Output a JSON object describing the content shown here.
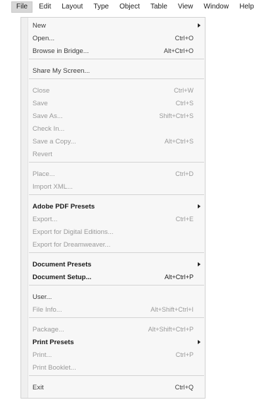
{
  "menubar": {
    "items": [
      {
        "label": "File"
      },
      {
        "label": "Edit"
      },
      {
        "label": "Layout"
      },
      {
        "label": "Type"
      },
      {
        "label": "Object"
      },
      {
        "label": "Table"
      },
      {
        "label": "View"
      },
      {
        "label": "Window"
      },
      {
        "label": "Help"
      }
    ]
  },
  "file_menu": {
    "items": [
      {
        "label": "New",
        "shortcut": "",
        "state": "normal",
        "submenu": true
      },
      {
        "label": "Open...",
        "shortcut": "Ctrl+O",
        "state": "normal",
        "submenu": false
      },
      {
        "label": "Browse in Bridge...",
        "shortcut": "Alt+Ctrl+O",
        "state": "normal",
        "submenu": false
      },
      {
        "label": "Share My Screen...",
        "shortcut": "",
        "state": "normal",
        "submenu": false
      },
      {
        "label": "Close",
        "shortcut": "Ctrl+W",
        "state": "disabled",
        "submenu": false
      },
      {
        "label": "Save",
        "shortcut": "Ctrl+S",
        "state": "disabled",
        "submenu": false
      },
      {
        "label": "Save As...",
        "shortcut": "Shift+Ctrl+S",
        "state": "disabled",
        "submenu": false
      },
      {
        "label": "Check In...",
        "shortcut": "",
        "state": "disabled",
        "submenu": false
      },
      {
        "label": "Save a Copy...",
        "shortcut": "Alt+Ctrl+S",
        "state": "disabled",
        "submenu": false
      },
      {
        "label": "Revert",
        "shortcut": "",
        "state": "disabled",
        "submenu": false
      },
      {
        "label": "Place...",
        "shortcut": "Ctrl+D",
        "state": "disabled",
        "submenu": false
      },
      {
        "label": "Import XML...",
        "shortcut": "",
        "state": "disabled",
        "submenu": false
      },
      {
        "label": "Adobe PDF Presets",
        "shortcut": "",
        "state": "enabled",
        "submenu": true
      },
      {
        "label": "Export...",
        "shortcut": "Ctrl+E",
        "state": "disabled",
        "submenu": false
      },
      {
        "label": "Export for Digital Editions...",
        "shortcut": "",
        "state": "disabled",
        "submenu": false
      },
      {
        "label": "Export for Dreamweaver...",
        "shortcut": "",
        "state": "disabled",
        "submenu": false
      },
      {
        "label": "Document Presets",
        "shortcut": "",
        "state": "enabled",
        "submenu": true
      },
      {
        "label": "Document Setup...",
        "shortcut": "Alt+Ctrl+P",
        "state": "enabled",
        "submenu": false
      },
      {
        "label": "User...",
        "shortcut": "",
        "state": "normal",
        "submenu": false
      },
      {
        "label": "File Info...",
        "shortcut": "Alt+Shift+Ctrl+I",
        "state": "disabled",
        "submenu": false
      },
      {
        "label": "Package...",
        "shortcut": "Alt+Shift+Ctrl+P",
        "state": "disabled",
        "submenu": false
      },
      {
        "label": "Print Presets",
        "shortcut": "",
        "state": "enabled",
        "submenu": true
      },
      {
        "label": "Print...",
        "shortcut": "Ctrl+P",
        "state": "disabled",
        "submenu": false
      },
      {
        "label": "Print Booklet...",
        "shortcut": "",
        "state": "disabled",
        "submenu": false
      },
      {
        "label": "Exit",
        "shortcut": "Ctrl+Q",
        "state": "normal",
        "submenu": false
      }
    ]
  },
  "colors": {
    "menu_background": "#f7f7f7",
    "disabled_text": "#9a9a9a",
    "enabled_text": "#1b1b1b",
    "active_menubar_item": "#d7d7d7"
  }
}
